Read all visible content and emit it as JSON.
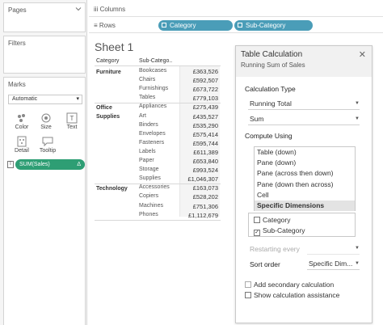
{
  "left_panel": {
    "pages_title": "Pages",
    "filters_title": "Filters",
    "marks_title": "Marks",
    "mark_type": "Automatic",
    "mark_buttons": [
      "Color",
      "Size",
      "Text",
      "Detail",
      "Tooltip"
    ],
    "sales_pill": "SUM(Sales)",
    "sales_pill_delta": "Δ"
  },
  "shelves": {
    "columns_label": "Columns",
    "rows_label": "Rows",
    "row_pills": [
      "Category",
      "Sub-Category"
    ]
  },
  "sheet": {
    "title": "Sheet 1",
    "headers": {
      "category": "Category",
      "subcategory": "Sub-Catego.."
    },
    "groups": [
      {
        "category": [
          "Furniture"
        ],
        "rows": [
          {
            "sub": "Bookcases",
            "value": "£363,526"
          },
          {
            "sub": "Chairs",
            "value": "£592,507"
          },
          {
            "sub": "Furnishings",
            "value": "£673,722"
          },
          {
            "sub": "Tables",
            "value": "£779,103"
          }
        ]
      },
      {
        "category": [
          "Office",
          "Supplies"
        ],
        "rows": [
          {
            "sub": "Appliances",
            "value": "£275,439"
          },
          {
            "sub": "Art",
            "value": "£435,527"
          },
          {
            "sub": "Binders",
            "value": "£535,290"
          },
          {
            "sub": "Envelopes",
            "value": "£575,414"
          },
          {
            "sub": "Fasteners",
            "value": "£595,744"
          },
          {
            "sub": "Labels",
            "value": "£611,389"
          },
          {
            "sub": "Paper",
            "value": "£653,840"
          },
          {
            "sub": "Storage",
            "value": "£993,524"
          },
          {
            "sub": "Supplies",
            "value": "£1,046,307"
          }
        ]
      },
      {
        "category": [
          "Technology"
        ],
        "rows": [
          {
            "sub": "Accessories",
            "value": "£163,073"
          },
          {
            "sub": "Copiers",
            "value": "£528,202"
          },
          {
            "sub": "Machines",
            "value": "£751,306"
          },
          {
            "sub": "Phones",
            "value": "£1,112,679"
          }
        ]
      }
    ]
  },
  "dialog": {
    "title": "Table Calculation",
    "subtitle": "Running Sum of Sales",
    "calc_type_label": "Calculation Type",
    "calc_type_value": "Running Total",
    "aggregation_value": "Sum",
    "compute_using_label": "Compute Using",
    "compute_options": [
      "Table (down)",
      "Pane (down)",
      "Pane (across then down)",
      "Pane (down then across)",
      "Cell",
      "Specific Dimensions"
    ],
    "selected_compute_option": 5,
    "dimensions": [
      {
        "label": "Category",
        "checked": false
      },
      {
        "label": "Sub-Category",
        "checked": true
      }
    ],
    "restarting_label": "Restarting every",
    "sort_label": "Sort order",
    "sort_value": "Specific Dim...",
    "secondary_calc_label": "Add secondary calculation",
    "assistance_label": "Show calculation assistance"
  }
}
